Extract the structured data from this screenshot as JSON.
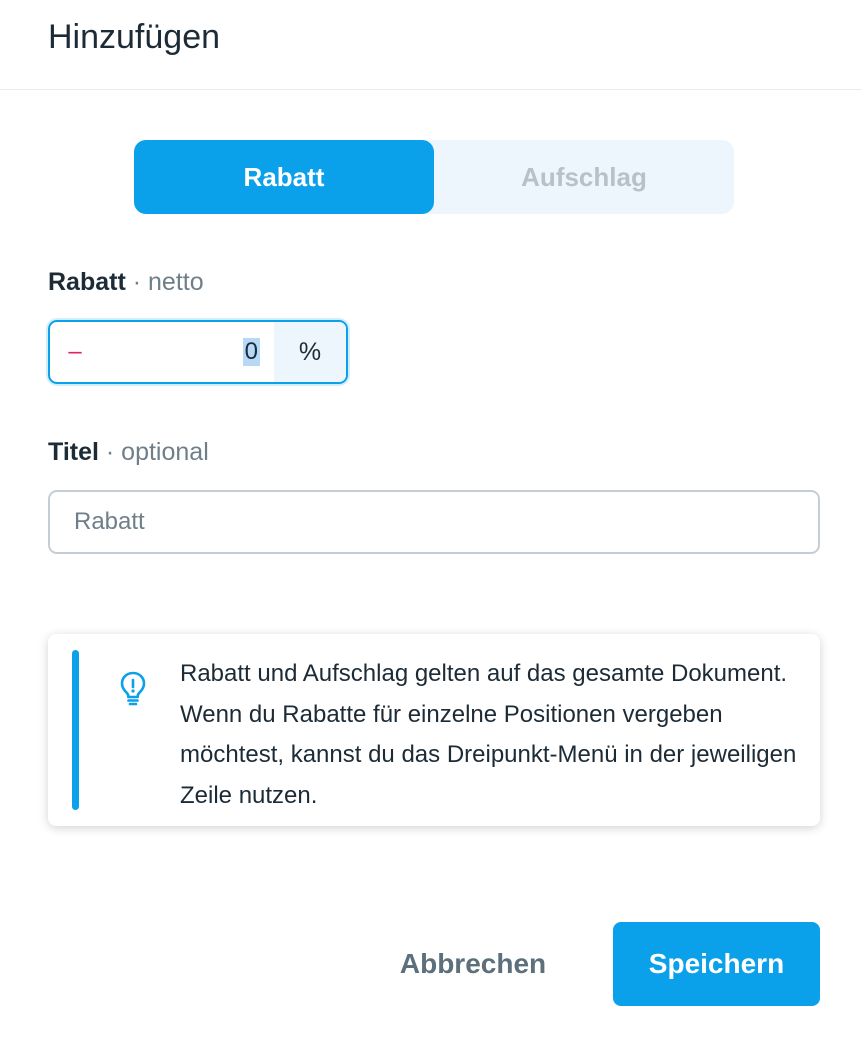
{
  "header": {
    "title": "Hinzufügen"
  },
  "type_toggle": {
    "options": [
      {
        "label": "Rabatt",
        "active": true
      },
      {
        "label": "Aufschlag",
        "active": false
      }
    ]
  },
  "amount_field": {
    "label": "Rabatt",
    "label_suffix": "· netto",
    "sign": "–",
    "value": "0",
    "unit": "%"
  },
  "title_field": {
    "label": "Titel",
    "label_suffix": "· optional",
    "placeholder": "Rabatt"
  },
  "info": {
    "icon": "lightbulb-icon",
    "text": "Rabatt und Aufschlag gelten auf das gesamte Dokument. Wenn du Rabatte für einzelne Positionen vergeben möchtest, kannst du das Dreipunkt-Menü in der jeweiligen Zeile nutzen."
  },
  "actions": {
    "cancel_label": "Abbrechen",
    "save_label": "Speichern"
  },
  "colors": {
    "accent": "#0aa0ea",
    "toggle_background": "#eef6fd",
    "negative_sign": "#e0245e"
  }
}
